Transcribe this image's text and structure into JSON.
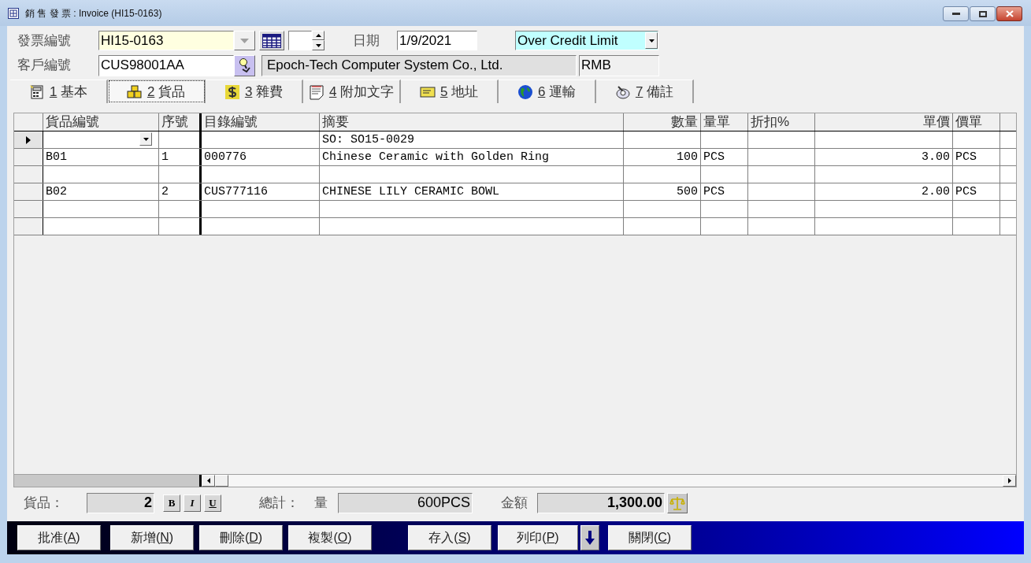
{
  "window": {
    "title": "銷 售 發 票 : Invoice (HI15-0163)"
  },
  "header": {
    "invoice_no_label": "發票編號",
    "invoice_no": "HI15-0163",
    "date_label": "日期",
    "date": "1/9/2021",
    "status": "Over Credit Limit",
    "customer_no_label": "客戶編號",
    "customer_no": "CUS98001AA",
    "customer_name": "Epoch-Tech Computer System Co., Ltd.",
    "currency": "RMB"
  },
  "tabs": [
    {
      "key": "1",
      "label": "基本",
      "kind": "calculator",
      "selected": false
    },
    {
      "key": "2",
      "label": "貨品",
      "kind": "boxes",
      "selected": true
    },
    {
      "key": "3",
      "label": "雜費",
      "kind": "dollar",
      "selected": false
    },
    {
      "key": "4",
      "label": "附加文字",
      "kind": "note",
      "selected": false
    },
    {
      "key": "5",
      "label": "地址",
      "kind": "envelope",
      "selected": false
    },
    {
      "key": "6",
      "label": "運輸",
      "kind": "globe",
      "selected": false
    },
    {
      "key": "7",
      "label": "備註",
      "kind": "writing",
      "selected": false
    }
  ],
  "table": {
    "columns": [
      "貨品編號",
      "序號",
      "目錄編號",
      "摘要",
      "數量",
      "量單",
      "折扣%",
      "單價",
      "價單"
    ],
    "rows": [
      {
        "current": true,
        "description": "SO: SO15-0029"
      },
      {
        "current": false,
        "item_no": "B01",
        "seq": "1",
        "catalog_no": "000776",
        "description": "Chinese Ceramic with Golden Ring",
        "qty": "100",
        "qty_unit": "PCS",
        "unit_price": "3.00",
        "price_unit": "PCS"
      },
      {
        "current": false
      },
      {
        "current": false,
        "item_no": "B02",
        "seq": "2",
        "catalog_no": "CUS777116",
        "description": "CHINESE LILY CERAMIC BOWL",
        "qty": "500",
        "qty_unit": "PCS",
        "unit_price": "2.00",
        "price_unit": "PCS"
      },
      {
        "current": false
      },
      {
        "current": false
      }
    ]
  },
  "totals": {
    "items_label": "貨品：",
    "items": "2",
    "format_buttons": [
      "B",
      "I",
      "U"
    ],
    "total_label": "總計：",
    "qty_label": "量",
    "qty": "600PCS",
    "amount_label": "金額",
    "amount": "1,300.00"
  },
  "buttons_left": [
    {
      "label": "批准(",
      "key": "A",
      "tail": ")"
    },
    {
      "label": "新增(",
      "key": "N",
      "tail": ")"
    },
    {
      "label": "刪除(",
      "key": "D",
      "tail": ")"
    },
    {
      "label": "複製(",
      "key": "O",
      "tail": ")"
    }
  ],
  "buttons_right": [
    {
      "kind": "text",
      "label": "存入(",
      "key": "S",
      "tail": ")"
    },
    {
      "kind": "text",
      "label": "列印(",
      "key": "P",
      "tail": ")"
    },
    {
      "kind": "arrow"
    },
    {
      "kind": "text",
      "label": "關閉(",
      "key": "C",
      "tail": ")"
    }
  ]
}
